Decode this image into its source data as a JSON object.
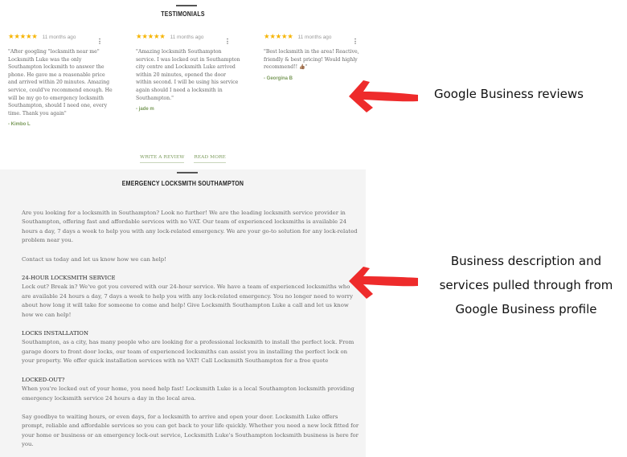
{
  "testimonials": {
    "title": "TESTIMONIALS",
    "reviews": [
      {
        "stars": "★★★★★",
        "rating": 5,
        "age": "11 months ago",
        "menu_icon": "more-vertical-icon",
        "text": "\"After googling \"locksmith near me\" Locksmith Luke was the only Southampton locksmith to answer the phone. He gave me a reasonable price and arrived within 20 minutes. Amazing service, could've recommend enough. He will be my go to emergency locksmith Southampton, should I need one, every time. Thank you again\"",
        "author": "- Kimbo L"
      },
      {
        "stars": "★★★★★",
        "rating": 5,
        "age": "11 months ago",
        "menu_icon": "more-vertical-icon",
        "text": "\"Amazing locksmith Southampton service. I was locked out in Southampton city centre and Locksmith Luke arrived within 20 minutes, opened the door within second. I will be using his service again should I need a locksmith in Southampton.\"",
        "author": "- jade m"
      },
      {
        "stars": "★★★★★",
        "rating": 5,
        "age": "11 months ago",
        "menu_icon": "more-vertical-icon",
        "text": "\"Best locksmith in the area! Reactive, friendly & best pricing! Would highly recommend!! 👍🏽\"",
        "author": "- Georgina B"
      }
    ],
    "write_review_label": "WRITE A REVIEW",
    "read_more_label": "READ MORE"
  },
  "emergency": {
    "title": "EMERGENCY LOCKSMITH SOUTHAMPTON",
    "intro": "Are you looking for a locksmith in Southampton? Look no further! We are the leading locksmith service provider in Southampton, offering fast and affordable services with no VAT. Our team of experienced locksmiths is available 24 hours a day, 7 days a week to help you with any lock-related emergency. We are your go-to solution for any lock-related problem near you.",
    "contact": "Contact us today and let us know how we can help!",
    "sections": [
      {
        "heading": "24-HOUR LOCKSMITH SERVICE",
        "body": "Lock out? Break in? We've got you covered with our 24-hour service. We have a team of experienced locksmiths who are available 24 hours a day, 7 days a week to help you with any lock-related emergency. You no longer need to worry about how long it will take for someone to come and help! Give Locksmith Southampton Luke a call and let us know how we can help!"
      },
      {
        "heading": "LOCKS INSTALLATION",
        "body": "Southampton, as a city, has many people who are looking for a professional locksmith to install the perfect lock. From garage doors to front door locks, our team of experienced locksmiths can assist you in installing the perfect lock on your property. We offer quick installation services with no VAT! Call Locksmith Southampton for a free quote"
      },
      {
        "heading": "LOCKED-OUT?",
        "body": "When you're locked out of your home, you need help fast! Locksmith Luke is a local Southampton locksmith providing emergency locksmith service 24 hours a day in the local area."
      }
    ],
    "closing": "Say goodbye to waiting hours, or even days, for a locksmith to arrive and open your door. Locksmith Luke offers prompt, reliable and affordable services so you can get back to your life quickly. Whether you need a new lock fitted for your home or business or an emergency lock-out service, Locksmith Luke's Southampton locksmith business is here for you."
  },
  "annotations": {
    "reviews_note": "Google Business reviews",
    "description_note": "Business description and services pulled through from Google Business profile",
    "description_note_lines": [
      "Business description and",
      "services pulled through from",
      "Google Business profile"
    ],
    "arrow_color": "#ee2b2b"
  },
  "colors": {
    "star": "#f6b400",
    "author": "#7a9a5a",
    "section_bg": "#f4f4f4"
  }
}
